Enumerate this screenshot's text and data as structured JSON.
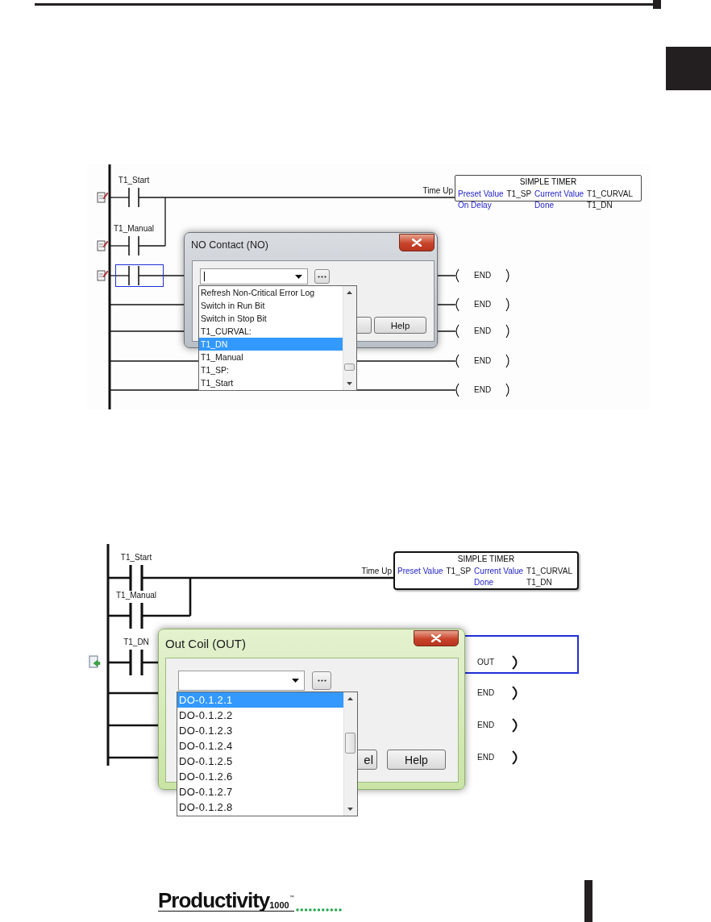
{
  "panels": [
    {
      "rungs": [
        {
          "contacts": [
            {
              "kind": "named",
              "label": "T1_Start"
            },
            {
              "kind": "named",
              "label": "T1_Manual"
            }
          ],
          "output": {
            "kind": "timer",
            "wire_label": "Time Up",
            "title": "SIMPLE TIMER",
            "rows": [
              [
                {
                  "kind": "name",
                  "text": "Preset Value"
                },
                {
                  "kind": "value",
                  "text": "T1_SP"
                },
                {
                  "kind": "name",
                  "text": "Current Value"
                },
                {
                  "kind": "value",
                  "text": "T1_CURVAL"
                }
              ],
              [
                {
                  "kind": "name",
                  "text": "On Delay"
                },
                {
                  "kind": "empty"
                },
                {
                  "kind": "name",
                  "text": "Done"
                },
                {
                  "kind": "value",
                  "text": "T1_DN"
                }
              ]
            ]
          },
          "selected": false
        },
        {
          "contacts": [
            {
              "kind": "blank"
            }
          ],
          "output": {
            "kind": "coil",
            "label": "END"
          },
          "selected": true
        },
        {
          "output": {
            "kind": "coil",
            "label": "END"
          },
          "selected": false
        },
        {
          "output": {
            "kind": "coil",
            "label": "END"
          },
          "selected": false
        },
        {
          "output": {
            "kind": "coil",
            "label": "END"
          },
          "selected": false
        },
        {
          "output": {
            "kind": "coil",
            "label": "END"
          },
          "selected": false
        }
      ],
      "dialog": {
        "title": "NO Contact (NO)",
        "combo": {
          "focused": true
        },
        "buttons": [
          {
            "kind": "covered"
          },
          {
            "kind": "push",
            "label": "Help"
          }
        ],
        "list": [
          {
            "label": "Refresh Non-Critical Error Log",
            "selected": false
          },
          {
            "label": "Switch in Run Bit",
            "selected": false
          },
          {
            "label": "Switch in Stop Bit",
            "selected": false
          },
          {
            "label": "T1_CURVAL:",
            "selected": false
          },
          {
            "label": "T1_DN",
            "selected": true
          },
          {
            "label": "T1_Manual",
            "selected": false
          },
          {
            "label": "T1_SP:",
            "selected": false
          },
          {
            "label": "T1_Start",
            "selected": false
          }
        ]
      }
    },
    {
      "rungs": [
        {
          "contacts": [
            {
              "kind": "named",
              "label": "T1_Start"
            },
            {
              "kind": "named",
              "label": "T1_Manual"
            }
          ],
          "output": {
            "kind": "timer",
            "wire_label": "Time Up",
            "title": "SIMPLE TIMER",
            "rows": [
              [
                {
                  "kind": "name",
                  "text": "Preset Value"
                },
                {
                  "kind": "value",
                  "text": "T1_SP"
                },
                {
                  "kind": "name",
                  "text": "Current Value"
                },
                {
                  "kind": "value",
                  "text": "T1_CURVAL"
                }
              ],
              [
                {
                  "kind": "empty"
                },
                {
                  "kind": "empty"
                },
                {
                  "kind": "name",
                  "text": "Done"
                },
                {
                  "kind": "value",
                  "text": "T1_DN"
                }
              ]
            ]
          },
          "selected": false
        },
        {
          "contacts": [
            {
              "kind": "named",
              "label": "T1_DN"
            }
          ],
          "output": {
            "kind": "coil",
            "label": "OUT"
          },
          "selected": true
        },
        {
          "output": {
            "kind": "coil",
            "label": "END"
          },
          "selected": false
        },
        {
          "output": {
            "kind": "coil",
            "label": "END"
          },
          "selected": false
        },
        {
          "output": {
            "kind": "coil",
            "label": "END"
          },
          "selected": false
        }
      ],
      "dialog": {
        "title": "Out Coil (OUT)",
        "combo": {
          "focused": false
        },
        "buttons": [
          {
            "kind": "covered",
            "label": "el"
          },
          {
            "kind": "push",
            "label": "Help"
          }
        ],
        "list": [
          {
            "label": "DO-0.1.2.1",
            "selected": true
          },
          {
            "label": "DO-0.1.2.2",
            "selected": false
          },
          {
            "label": "DO-0.1.2.3",
            "selected": false
          },
          {
            "label": "DO-0.1.2.4",
            "selected": false
          },
          {
            "label": "DO-0.1.2.5",
            "selected": false
          },
          {
            "label": "DO-0.1.2.6",
            "selected": false
          },
          {
            "label": "DO-0.1.2.7",
            "selected": false
          },
          {
            "label": "DO-0.1.2.8",
            "selected": false
          }
        ]
      }
    }
  ],
  "footer": {
    "logo": {
      "name": "Productivity",
      "model": "1000",
      "mark": "™"
    }
  }
}
